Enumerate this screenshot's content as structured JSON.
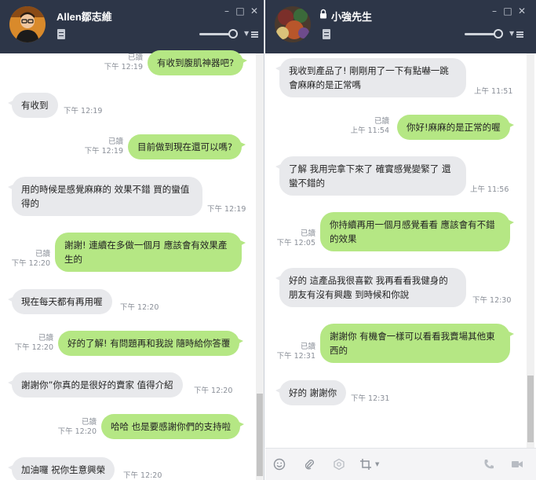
{
  "left_chat": {
    "contact_name": "Allen鄒志維",
    "window_controls": {
      "minimize": "–",
      "maximize": "□",
      "close": "✕"
    },
    "messages": [
      {
        "dir": "out",
        "text": "有收到腹肌神器吧?",
        "read": "已讀",
        "time": "下午 12:19"
      },
      {
        "dir": "in",
        "text": "有收到",
        "time": "下午 12:19"
      },
      {
        "dir": "out",
        "text": "目前做到現在還可以嗎?",
        "read": "已讀",
        "time": "下午 12:19"
      },
      {
        "dir": "in",
        "text": "用的時候是感覺麻麻的 效果不錯 買的蠻值得的",
        "time": "下午 12:19"
      },
      {
        "dir": "out",
        "text": "謝謝! 連續在多做一個月 應該會有效果產生的",
        "read": "已讀",
        "time": "下午 12:20"
      },
      {
        "dir": "in",
        "text": "現在每天都有再用喔",
        "time": "下午 12:20"
      },
      {
        "dir": "out",
        "text": "好的了解! 有問題再和我說 隨時給你答覆",
        "read": "已讀",
        "time": "下午 12:20"
      },
      {
        "dir": "in",
        "text": "謝謝你”你真的是很好的賣家 值得介紹",
        "time": "下午 12:20"
      },
      {
        "dir": "out",
        "text": "哈哈 也是要感謝你們的支持啦",
        "read": "已讀",
        "time": "下午 12:20"
      },
      {
        "dir": "in",
        "text": "加油囉 祝你生意興榮",
        "time": "下午 12:20"
      }
    ]
  },
  "right_chat": {
    "contact_name": "小強先生",
    "window_controls": {
      "minimize": "–",
      "maximize": "□",
      "close": "✕"
    },
    "messages": [
      {
        "dir": "in",
        "text": "我收到產品了! 剛剛用了一下有點嚇一跳 會麻麻的是正常嗎",
        "time": "上午 11:51"
      },
      {
        "dir": "out",
        "text": "你好!麻麻的是正常的喔",
        "read": "已讀",
        "time": "上午 11:54"
      },
      {
        "dir": "in",
        "text": "了解 我用完拿下來了 確實感覺變緊了 還蠻不錯的",
        "time": "上午 11:56"
      },
      {
        "dir": "out",
        "text": "你持續再用一個月感覺看看 應該會有不錯的效果",
        "read": "已讀",
        "time": "下午 12:05"
      },
      {
        "dir": "in",
        "text": "好的 這產品我很喜歡 我再看看我健身的朋友有沒有興趣 到時候和你說",
        "time": "下午 12:30"
      },
      {
        "dir": "out",
        "text": "謝謝你 有機會一樣可以看看我賣場其他東西的",
        "read": "已讀",
        "time": "下午 12:31"
      },
      {
        "dir": "in",
        "text": "好的 謝謝你",
        "time": "下午 12:31"
      }
    ],
    "footer_icons": [
      "emoji-icon",
      "attach-icon",
      "coin-icon",
      "crop-icon",
      "phone-icon",
      "video-icon"
    ]
  },
  "colors": {
    "header": "#2d3648",
    "incoming_bubble": "#e8e9ec",
    "outgoing_bubble": "#b5e784"
  }
}
